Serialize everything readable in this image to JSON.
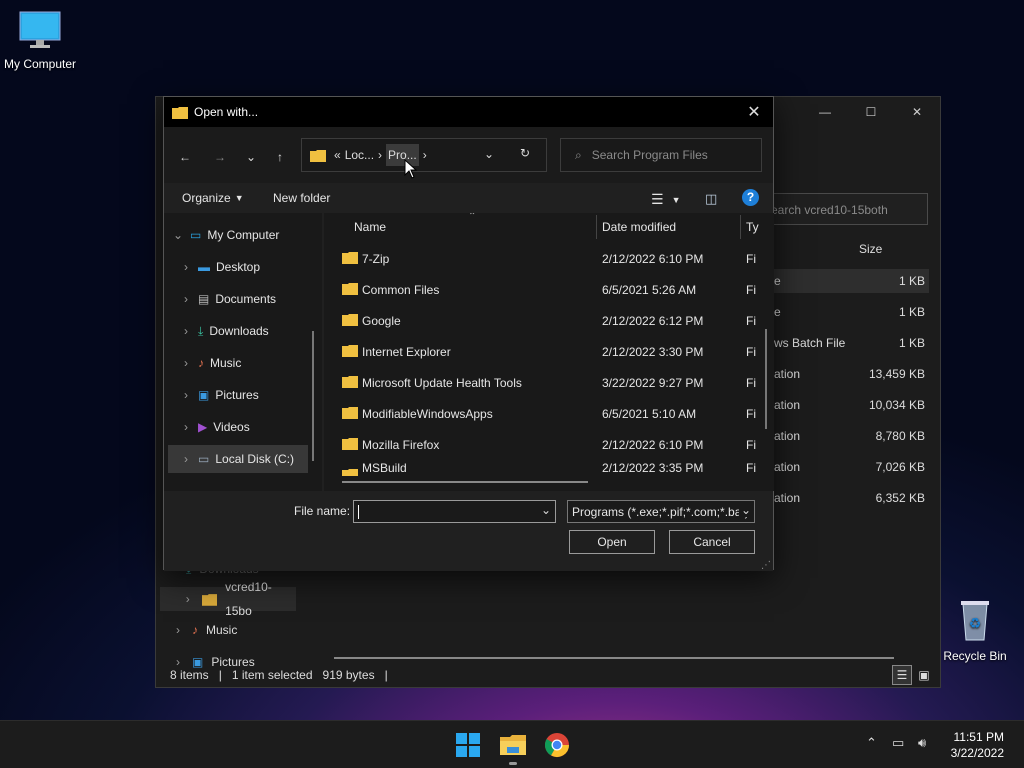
{
  "desktop": {
    "my_computer_label": "My Computer",
    "recycle_bin_label": "Recycle Bin"
  },
  "bg_explorer": {
    "search_placeholder": "earch vcred10-15both",
    "col_size": "Size",
    "rows": [
      {
        "type": "e",
        "size": "1 KB"
      },
      {
        "type": "e",
        "size": "1 KB"
      },
      {
        "type": "ws Batch File",
        "size": "1 KB"
      },
      {
        "type": "ation",
        "size": "13,459 KB"
      },
      {
        "type": "ation",
        "size": "10,034 KB"
      },
      {
        "type": "ation",
        "size": "8,780 KB"
      },
      {
        "type": "ation",
        "size": "7,026 KB"
      },
      {
        "type": "ation",
        "size": "6,352 KB"
      }
    ],
    "nav": {
      "downloads": "Downloads",
      "vcred": "vcred10-15bo",
      "music": "Music",
      "pictures": "Pictures"
    },
    "status": {
      "items": "8 items",
      "selected": "1 item selected",
      "size": "919 bytes"
    }
  },
  "dialog": {
    "title": "Open with...",
    "address": {
      "sep": "«",
      "crumb1": "Loc...",
      "crumb2": "Pro..."
    },
    "search_placeholder": "Search Program Files",
    "organize_label": "Organize",
    "new_folder_label": "New folder",
    "help_glyph": "?",
    "tree": [
      {
        "label": "My Computer",
        "expanded": true
      },
      {
        "label": "Desktop"
      },
      {
        "label": "Documents"
      },
      {
        "label": "Downloads"
      },
      {
        "label": "Music"
      },
      {
        "label": "Pictures"
      },
      {
        "label": "Videos"
      },
      {
        "label": "Local Disk (C:)",
        "selected": true
      }
    ],
    "columns": {
      "name": "Name",
      "date": "Date modified",
      "type": "Ty"
    },
    "files": [
      {
        "name": "7-Zip",
        "date": "2/12/2022 6:10 PM",
        "type": "Fi"
      },
      {
        "name": "Common Files",
        "date": "6/5/2021 5:26 AM",
        "type": "Fi"
      },
      {
        "name": "Google",
        "date": "2/12/2022 6:12 PM",
        "type": "Fi"
      },
      {
        "name": "Internet Explorer",
        "date": "2/12/2022 3:30 PM",
        "type": "Fi"
      },
      {
        "name": "Microsoft Update Health Tools",
        "date": "3/22/2022 9:27 PM",
        "type": "Fi"
      },
      {
        "name": "ModifiableWindowsApps",
        "date": "6/5/2021 5:10 AM",
        "type": "Fi"
      },
      {
        "name": "Mozilla Firefox",
        "date": "2/12/2022 6:10 PM",
        "type": "Fi"
      },
      {
        "name": "MSBuild",
        "date": "2/12/2022 3:35 PM",
        "type": "Fi"
      }
    ],
    "file_name_label": "File name:",
    "file_name_value": "",
    "filter_value": "Programs (*.exe;*.pif;*.com;*.bat)",
    "open_label": "Open",
    "cancel_label": "Cancel"
  },
  "taskbar": {
    "time": "11:51 PM",
    "date": "3/22/2022"
  },
  "colors": {
    "accent": "#0078d4",
    "folder": "#f0c040"
  }
}
